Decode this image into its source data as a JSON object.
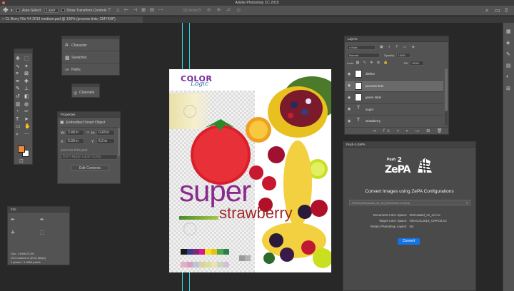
{
  "app": {
    "title": "Adobe Photoshop CC 2019"
  },
  "options_bar": {
    "auto_select_label": "Auto-Select:",
    "auto_select_value": "Layer",
    "transform_controls_label": "Show Transform Controls",
    "mode_3d_label": "3D Mode:"
  },
  "document_tab": {
    "label": "CL Berry File V4 2019 medium.psd @ 100% (process tints, CMYK/8*)"
  },
  "mini_panels": {
    "character": "Character",
    "swatches": "Swatches",
    "paths": "Paths",
    "channels": "Channels"
  },
  "properties": {
    "title": "Properties",
    "subtitle": "Embedded Smart Object",
    "w_label": "W:",
    "w_value": "2.48 in",
    "h_label": "H:",
    "h_value": "0.43 in",
    "x_label": "X:",
    "x_value": "0.39 in",
    "y_label": "Y:",
    "y_value": "6.2 in",
    "layer_comp_label": "process tints.psb",
    "layer_comp_value": "Don't Apply Layer Comp",
    "edit_button": "Edit Contents"
  },
  "info": {
    "title": "Info",
    "doc_line": "Doc: 1.60M/23.2M",
    "profile_line": "ISO Coated v2 (ECI) (8bpc)",
    "size_line": "1 pixels = 1.0000 pixels"
  },
  "layers": {
    "title": "Layers",
    "kind_label": "Kind",
    "blend_mode": "Normal",
    "opacity_label": "Opacity:",
    "opacity_value": "100%",
    "lock_label": "Lock:",
    "fill_label": "Fill:",
    "fill_value": "100%",
    "items": [
      {
        "name": "dieline",
        "selected": false,
        "type": "image"
      },
      {
        "name": "process tints",
        "selected": true,
        "type": "image"
      },
      {
        "name": "green label",
        "selected": false,
        "type": "image"
      },
      {
        "name": "super",
        "selected": false,
        "type": "text"
      },
      {
        "name": "strawberry",
        "selected": false,
        "type": "text"
      }
    ]
  },
  "push2zepa": {
    "title": "Push-2-ZePA",
    "logo_top": "Push",
    "logo_main": "ZePA",
    "logo_num": "2",
    "heading": "Convert Images using ZePA Configurations",
    "dropdown_value": "PSO3 (ISOcoated_v2_eci_ISO12647-2-2013)",
    "doc_space_label": "Document Color Space:",
    "doc_space_value": "ISOcoated_v2_eci.icc",
    "target_space_label": "Target Color Space:",
    "target_space_value": "GRACoL2013_CRPC6.icc",
    "retain_label": "Retain Photoshop Layers:",
    "retain_value": "No",
    "convert_button": "Convert"
  },
  "artwork": {
    "logo_color": "COLOR",
    "logo_logic": "Logic",
    "word_super": "super",
    "word_strawberry": "strawberry",
    "swatches_top": [
      "#1a1a1a",
      "#3b3b8f",
      "#7a2a7a",
      "#d8188c",
      "#f2e21a",
      "#e8c21a",
      "#4aa84a",
      "#2c7f4a"
    ],
    "swatches_bottom": [
      "#e0b0c8",
      "#d8a0c0",
      "#b7c7d8",
      "#e0d0a0",
      "#d8e0a0",
      "#f0e0b0",
      "#c8d8c0",
      "#d0c0d8"
    ],
    "swatches_gray": [
      "#9a9a9a",
      "#b0b0b0"
    ]
  },
  "colors": {
    "foreground": "#f08a33",
    "background": "#ffffff",
    "accent": "#1473e6"
  }
}
